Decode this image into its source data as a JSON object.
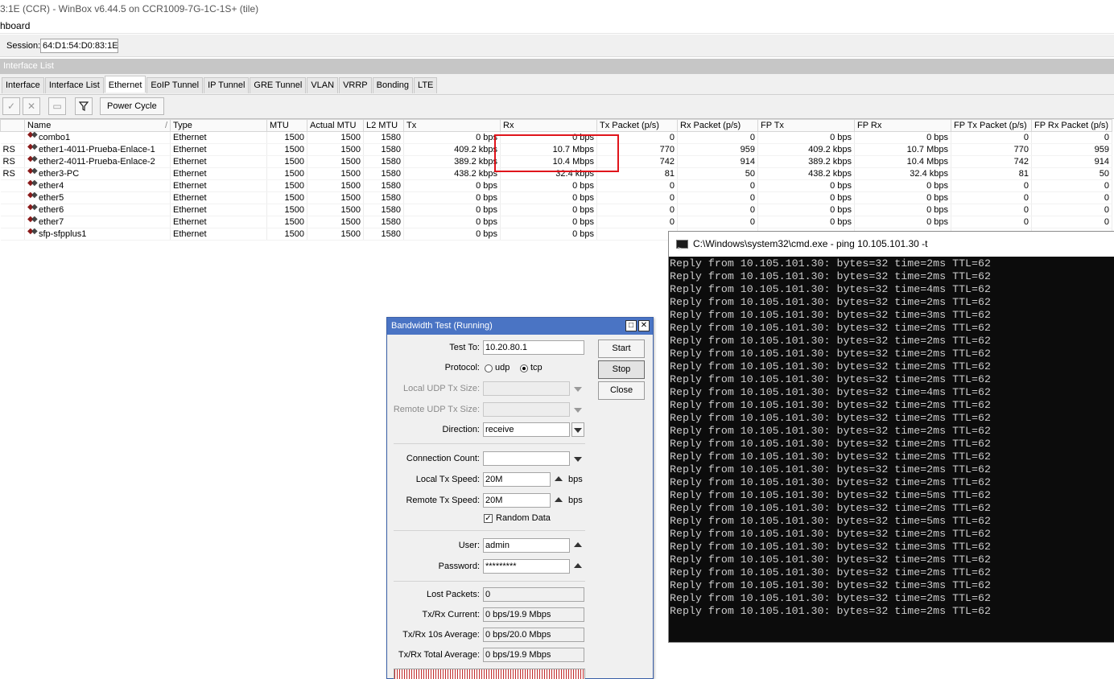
{
  "window": {
    "title": "3:1E (CCR) - WinBox v6.44.5 on CCR1009-7G-1C-1S+ (tile)",
    "menu_text": "hboard"
  },
  "session": {
    "label": "Session:",
    "value": "64:D1:54:D0:83:1E"
  },
  "interface_list": {
    "header": "Interface List",
    "tabs": [
      "Interface",
      "Interface List",
      "Ethernet",
      "EoIP Tunnel",
      "IP Tunnel",
      "GRE Tunnel",
      "VLAN",
      "VRRP",
      "Bonding",
      "LTE"
    ],
    "active_tab": "Ethernet",
    "toolbar": {
      "enable_icon": "check-icon",
      "disable_icon": "x-icon",
      "comment_icon": "comment-icon",
      "filter_icon": "filter-icon",
      "power_cycle_label": "Power Cycle"
    },
    "columns": [
      "Name",
      "Type",
      "MTU",
      "Actual MTU",
      "L2 MTU",
      "Tx",
      "Rx",
      "Tx Packet (p/s)",
      "Rx Packet (p/s)",
      "FP Tx",
      "FP Rx",
      "FP Tx Packet (p/s)",
      "FP Rx Packet (p/s)"
    ],
    "rows": [
      {
        "flag": "",
        "name": "combo1",
        "type": "Ethernet",
        "mtu": "1500",
        "actual_mtu": "1500",
        "l2_mtu": "1580",
        "tx": "0 bps",
        "rx": "0 bps",
        "tx_pps": "0",
        "rx_pps": "0",
        "fp_tx": "0 bps",
        "fp_rx": "0 bps",
        "fp_tx_pps": "0",
        "fp_rx_pps": "0"
      },
      {
        "flag": "RS",
        "name": "ether1-4011-Prueba-Enlace-1",
        "type": "Ethernet",
        "mtu": "1500",
        "actual_mtu": "1500",
        "l2_mtu": "1580",
        "tx": "409.2 kbps",
        "rx": "10.7 Mbps",
        "tx_pps": "770",
        "rx_pps": "959",
        "fp_tx": "409.2 kbps",
        "fp_rx": "10.7 Mbps",
        "fp_tx_pps": "770",
        "fp_rx_pps": "959"
      },
      {
        "flag": "RS",
        "name": "ether2-4011-Prueba-Enlace-2",
        "type": "Ethernet",
        "mtu": "1500",
        "actual_mtu": "1500",
        "l2_mtu": "1580",
        "tx": "389.2 kbps",
        "rx": "10.4 Mbps",
        "tx_pps": "742",
        "rx_pps": "914",
        "fp_tx": "389.2 kbps",
        "fp_rx": "10.4 Mbps",
        "fp_tx_pps": "742",
        "fp_rx_pps": "914"
      },
      {
        "flag": "RS",
        "name": "ether3-PC",
        "type": "Ethernet",
        "mtu": "1500",
        "actual_mtu": "1500",
        "l2_mtu": "1580",
        "tx": "438.2 kbps",
        "rx": "32.4 kbps",
        "tx_pps": "81",
        "rx_pps": "50",
        "fp_tx": "438.2 kbps",
        "fp_rx": "32.4 kbps",
        "fp_tx_pps": "81",
        "fp_rx_pps": "50"
      },
      {
        "flag": "",
        "name": "ether4",
        "type": "Ethernet",
        "mtu": "1500",
        "actual_mtu": "1500",
        "l2_mtu": "1580",
        "tx": "0 bps",
        "rx": "0 bps",
        "tx_pps": "0",
        "rx_pps": "0",
        "fp_tx": "0 bps",
        "fp_rx": "0 bps",
        "fp_tx_pps": "0",
        "fp_rx_pps": "0"
      },
      {
        "flag": "",
        "name": "ether5",
        "type": "Ethernet",
        "mtu": "1500",
        "actual_mtu": "1500",
        "l2_mtu": "1580",
        "tx": "0 bps",
        "rx": "0 bps",
        "tx_pps": "0",
        "rx_pps": "0",
        "fp_tx": "0 bps",
        "fp_rx": "0 bps",
        "fp_tx_pps": "0",
        "fp_rx_pps": "0"
      },
      {
        "flag": "",
        "name": "ether6",
        "type": "Ethernet",
        "mtu": "1500",
        "actual_mtu": "1500",
        "l2_mtu": "1580",
        "tx": "0 bps",
        "rx": "0 bps",
        "tx_pps": "0",
        "rx_pps": "0",
        "fp_tx": "0 bps",
        "fp_rx": "0 bps",
        "fp_tx_pps": "0",
        "fp_rx_pps": "0"
      },
      {
        "flag": "",
        "name": "ether7",
        "type": "Ethernet",
        "mtu": "1500",
        "actual_mtu": "1500",
        "l2_mtu": "1580",
        "tx": "0 bps",
        "rx": "0 bps",
        "tx_pps": "0",
        "rx_pps": "0",
        "fp_tx": "0 bps",
        "fp_rx": "0 bps",
        "fp_tx_pps": "0",
        "fp_rx_pps": "0"
      },
      {
        "flag": "",
        "name": "sfp-sfpplus1",
        "type": "Ethernet",
        "mtu": "1500",
        "actual_mtu": "1500",
        "l2_mtu": "1580",
        "tx": "0 bps",
        "rx": "0 bps",
        "tx_pps": "",
        "rx_pps": "",
        "fp_tx": "",
        "fp_rx": "",
        "fp_tx_pps": "",
        "fp_rx_pps": ""
      }
    ]
  },
  "bandwidth_test": {
    "title": "Bandwidth Test (Running)",
    "test_to_label": "Test To:",
    "test_to": "10.20.80.1",
    "protocol_label": "Protocol:",
    "protocol_udp": "udp",
    "protocol_tcp": "tcp",
    "protocol_selected": "tcp",
    "local_udp_label": "Local UDP Tx Size:",
    "remote_udp_label": "Remote UDP Tx Size:",
    "direction_label": "Direction:",
    "direction": "receive",
    "connection_count_label": "Connection Count:",
    "local_tx_speed_label": "Local Tx Speed:",
    "local_tx_speed": "20M",
    "remote_tx_speed_label": "Remote Tx Speed:",
    "remote_tx_speed": "20M",
    "unit": "bps",
    "random_data_label": "Random Data",
    "random_data_checked": true,
    "user_label": "User:",
    "user": "admin",
    "password_label": "Password:",
    "password": "*********",
    "lost_packets_label": "Lost Packets:",
    "lost_packets": "0",
    "current_label": "Tx/Rx Current:",
    "current": "0 bps/19.9 Mbps",
    "avg10_label": "Tx/Rx 10s Average:",
    "avg10": "0 bps/20.0 Mbps",
    "total_label": "Tx/Rx Total Average:",
    "total": "0 bps/19.9 Mbps",
    "start_label": "Start",
    "stop_label": "Stop",
    "close_label": "Close"
  },
  "cmd": {
    "title": "C:\\Windows\\system32\\cmd.exe - ping  10.105.101.30 -t",
    "lines": [
      "Reply from 10.105.101.30: bytes=32 time=2ms TTL=62",
      "Reply from 10.105.101.30: bytes=32 time=2ms TTL=62",
      "Reply from 10.105.101.30: bytes=32 time=4ms TTL=62",
      "Reply from 10.105.101.30: bytes=32 time=2ms TTL=62",
      "Reply from 10.105.101.30: bytes=32 time=3ms TTL=62",
      "Reply from 10.105.101.30: bytes=32 time=2ms TTL=62",
      "Reply from 10.105.101.30: bytes=32 time=2ms TTL=62",
      "Reply from 10.105.101.30: bytes=32 time=2ms TTL=62",
      "Reply from 10.105.101.30: bytes=32 time=2ms TTL=62",
      "Reply from 10.105.101.30: bytes=32 time=2ms TTL=62",
      "Reply from 10.105.101.30: bytes=32 time=4ms TTL=62",
      "Reply from 10.105.101.30: bytes=32 time=2ms TTL=62",
      "Reply from 10.105.101.30: bytes=32 time=2ms TTL=62",
      "Reply from 10.105.101.30: bytes=32 time=2ms TTL=62",
      "Reply from 10.105.101.30: bytes=32 time=2ms TTL=62",
      "Reply from 10.105.101.30: bytes=32 time=2ms TTL=62",
      "Reply from 10.105.101.30: bytes=32 time=2ms TTL=62",
      "Reply from 10.105.101.30: bytes=32 time=2ms TTL=62",
      "Reply from 10.105.101.30: bytes=32 time=5ms TTL=62",
      "Reply from 10.105.101.30: bytes=32 time=2ms TTL=62",
      "Reply from 10.105.101.30: bytes=32 time=5ms TTL=62",
      "Reply from 10.105.101.30: bytes=32 time=2ms TTL=62",
      "Reply from 10.105.101.30: bytes=32 time=3ms TTL=62",
      "Reply from 10.105.101.30: bytes=32 time=2ms TTL=62",
      "Reply from 10.105.101.30: bytes=32 time=2ms TTL=62",
      "Reply from 10.105.101.30: bytes=32 time=3ms TTL=62",
      "Reply from 10.105.101.30: bytes=32 time=2ms TTL=62",
      "Reply from 10.105.101.30: bytes=32 time=2ms TTL=62"
    ]
  },
  "colors": {
    "highlight": "#e0141b",
    "titlebar": "#4a74c4",
    "graph": "#c12a2a"
  }
}
